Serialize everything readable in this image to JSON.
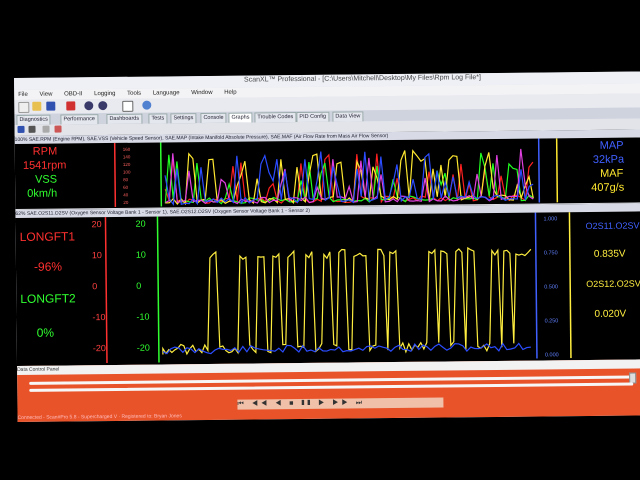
{
  "window": {
    "title": "ScanXL™ Professional - [C:\\Users\\Mitchell\\Desktop\\My Files\\Rpm Log File*]"
  },
  "menu": [
    "File",
    "View",
    "OBD-II",
    "Logging",
    "Tools",
    "Language",
    "Window",
    "Help"
  ],
  "tabs": [
    "Diagnostics",
    "Performance",
    "Dashboards",
    "Tests",
    "Settings",
    "Console",
    "Graphs",
    "Trouble Codes",
    "PID Config",
    "Data View"
  ],
  "active_tab": "Graphs",
  "panel1": {
    "title": "100% SAE.RPM (Engine RPM), SAE.VSS (Vehicle Speed Sensor), SAE.MAP (Intake Manifold Absolute Pressure), SAE.MAF (Air Flow Rate from Mass Air Flow Sensor)",
    "left_labels": {
      "rpm_name": "RPM",
      "rpm_value": "1541rpm",
      "vss_name": "VSS",
      "vss_value": "0km/h"
    },
    "right_labels": {
      "map_name": "MAP",
      "map_value": "32kPa",
      "maf_name": "MAF",
      "maf_value": "407g/s"
    },
    "axis_ticks": [
      "160",
      "140",
      "120",
      "100",
      "80",
      "60",
      "40",
      "20"
    ]
  },
  "panel2": {
    "title": "62% SAE.O2S11.O2SV (Oxygen Sensor Voltage Bank 1 - Sensor 1), SAE.O2S12.O2SV (Oxygen Sensor Voltage Bank 1 - Sensor 2)",
    "left_labels": {
      "lt1_name": "LONGFT1",
      "lt1_value": "-96%",
      "lt2_name": "LONGFT2",
      "lt2_value": "0%"
    },
    "right_labels": {
      "s11_name": "O2S11.O2SV",
      "s11_value": "0.835V",
      "s12_name": "O2S12.O2SV",
      "s12_value": "0.020V"
    },
    "left_ticks": [
      "20",
      "10",
      "0",
      "-10",
      "-20"
    ],
    "right_ticks": [
      "1.000",
      "0.750",
      "0.500",
      "0.250",
      "0.000"
    ]
  },
  "data_control": {
    "title": "Data Control Panel",
    "controls": "⏮ ◀◀ ◀ ■ ❚❚ ▶ ▶▶ ⏭"
  },
  "status": "Connected - Scan#Pro 5.8 - Supercharged V · Registered to: Bryan Jones",
  "colors": {
    "rpm": "#ff2020",
    "vss": "#20ff20",
    "map": "#2b4dff",
    "maf": "#ffe830",
    "o2s11": "#2b4dff",
    "o2s12": "#ffee40"
  }
}
